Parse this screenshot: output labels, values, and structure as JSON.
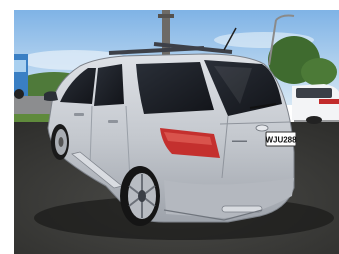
{
  "photo": {
    "subject": "car-rear-three-quarter",
    "plate": "WJU288",
    "colors": {
      "sky_top": "#7fb3e6",
      "sky_bottom": "#cfe3f3",
      "car_body": "#c9ccd2",
      "car_shadow": "#8e939b",
      "glass": "#1d2128",
      "taillight": "#c4302e",
      "ground": "#3a3a38",
      "grass": "#5f8a3c"
    }
  }
}
